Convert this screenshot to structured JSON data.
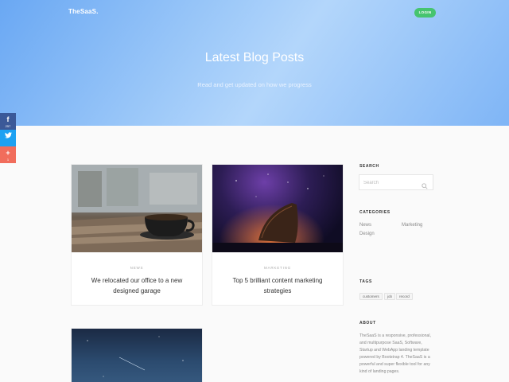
{
  "header": {
    "brand": "TheSaaS.",
    "login_label": "LOGIN"
  },
  "hero": {
    "title": "Latest Blog Posts",
    "subtitle": "Read and get updated on how we progress"
  },
  "social": [
    {
      "network": "facebook",
      "icon": "f",
      "count": "257"
    },
    {
      "network": "twitter",
      "icon": "twitter-bird"
    },
    {
      "network": "google-plus",
      "icon": "+",
      "count": "1"
    }
  ],
  "posts": [
    {
      "category": "NEWS",
      "title": "We relocated our office to a new designed garage"
    },
    {
      "category": "MARKETING",
      "title": "Top 5 brilliant content marketing strategies"
    },
    {
      "category": "",
      "title": ""
    }
  ],
  "sidebar": {
    "search": {
      "heading": "SEARCH",
      "placeholder": "Search"
    },
    "categories": {
      "heading": "CATEGORIES",
      "items": [
        "News",
        "Marketing",
        "Design"
      ]
    },
    "tags": {
      "heading": "TAGS",
      "items": [
        "customers",
        "job",
        "record"
      ]
    },
    "about": {
      "heading": "ABOUT",
      "text": "TheSaaS is a responsive, professional, and multipurpose SaaS, Software, Startup and WebApp landing template powered by Bootstrap 4. TheSaaS is a powerful and super flexible tool for any kind of landing pages."
    }
  },
  "colors": {
    "login": "#46c46f",
    "facebook": "#3b5998",
    "twitter": "#1da1f2",
    "google_plus": "#f16d5c"
  }
}
